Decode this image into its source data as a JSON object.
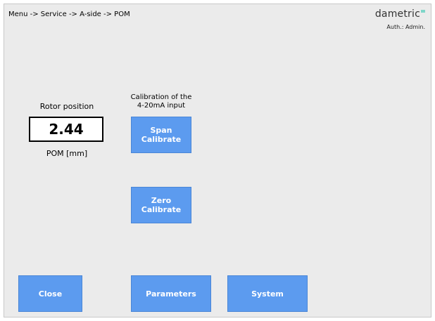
{
  "header": {
    "breadcrumb": "Menu -> Service -> A-side -> POM",
    "logo_text": "dametric",
    "auth": "Auth.: Admin."
  },
  "rotor": {
    "label": "Rotor position",
    "value": "2.44",
    "unit": "POM [mm]"
  },
  "calibration": {
    "title_line1": "Calibration of the",
    "title_line2": "4-20mA input",
    "span_line1": "Span",
    "span_line2": "Calibrate",
    "zero_line1": "Zero",
    "zero_line2": "Calibrate"
  },
  "footer": {
    "close": "Close",
    "parameters": "Parameters",
    "system": "System"
  },
  "colors": {
    "button": "#5c9bef",
    "background": "#ebebeb",
    "logo_accent": "#7fd6c9"
  }
}
